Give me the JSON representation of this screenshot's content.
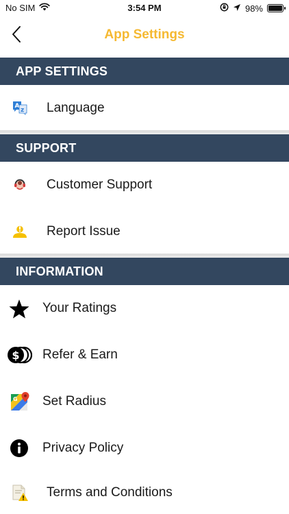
{
  "status_bar": {
    "carrier": "No SIM",
    "time": "3:54 PM",
    "battery_text": "98%",
    "battery_level": 0.98
  },
  "nav": {
    "title": "App Settings",
    "back_icon": "chevron-left-icon",
    "title_color": "#f5b932"
  },
  "sections": {
    "app_settings": {
      "header": "APP SETTINGS",
      "items": [
        {
          "label": "Language",
          "icon": "translate-icon"
        }
      ]
    },
    "support": {
      "header": "SUPPORT",
      "items": [
        {
          "label": "Customer Support",
          "icon": "headset-icon"
        },
        {
          "label": "Report Issue",
          "icon": "report-person-icon"
        }
      ]
    },
    "information": {
      "header": "INFORMATION",
      "items": [
        {
          "label": "Your Ratings",
          "icon": "star-icon"
        },
        {
          "label": "Refer & Earn",
          "icon": "coins-icon"
        },
        {
          "label": "Set Radius",
          "icon": "map-icon"
        },
        {
          "label": "Privacy Policy",
          "icon": "info-icon"
        },
        {
          "label": "Terms and Conditions",
          "icon": "document-warning-icon"
        }
      ]
    }
  },
  "colors": {
    "header_bg": "#33475f",
    "accent": "#f5b932"
  }
}
